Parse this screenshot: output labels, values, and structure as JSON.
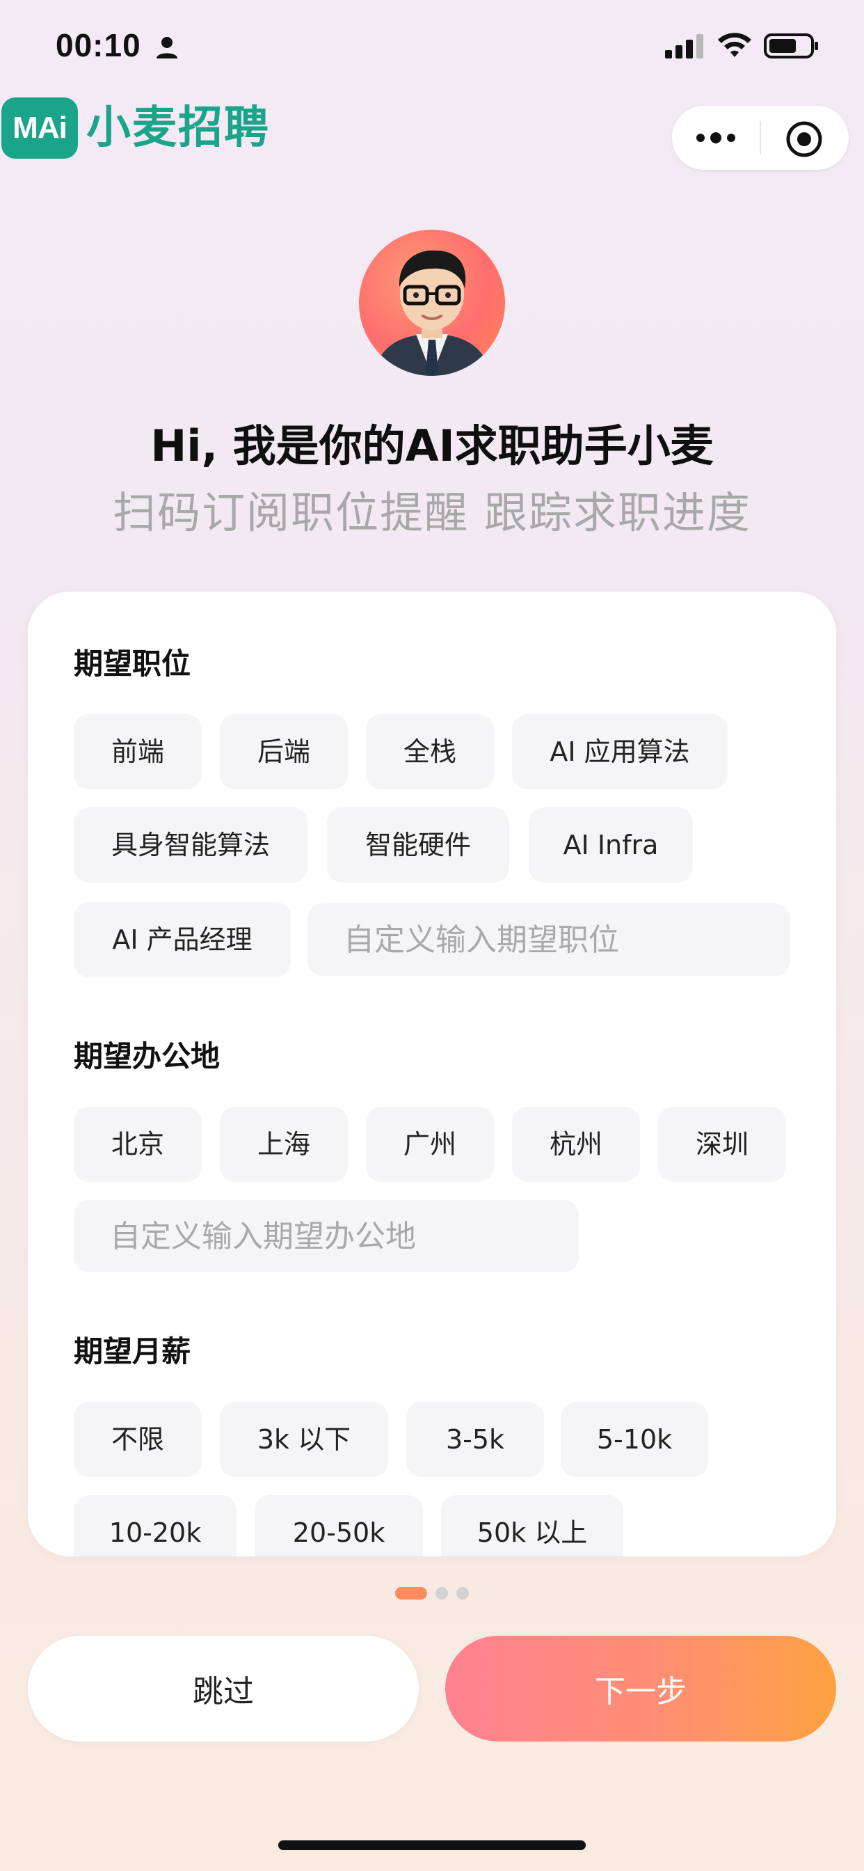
{
  "status_bar": {
    "time": "00:10"
  },
  "header": {
    "logo_text": "MAi",
    "brand_name": "小麦招聘"
  },
  "intro": {
    "headline": "Hi, 我是你的AI求职助手小麦",
    "subline": "扫码订阅职位提醒 跟踪求职进度"
  },
  "form": {
    "position": {
      "title": "期望职位",
      "options": [
        "前端",
        "后端",
        "全栈",
        "AI 应用算法",
        "具身智能算法",
        "智能硬件",
        "AI Infra",
        "AI 产品经理"
      ],
      "custom_placeholder": "自定义输入期望职位"
    },
    "location": {
      "title": "期望办公地",
      "options": [
        "北京",
        "上海",
        "广州",
        "杭州",
        "深圳"
      ],
      "custom_placeholder": "自定义输入期望办公地"
    },
    "salary": {
      "title": "期望月薪",
      "options": [
        "不限",
        "3k 以下",
        "3-5k",
        "5-10k",
        "10-20k",
        "20-50k",
        "50k 以上"
      ]
    }
  },
  "pager": {
    "current": 1,
    "total": 3,
    "active_color": "#ff8a5c",
    "inactive_color": "#d2d2d2"
  },
  "actions": {
    "skip_label": "跳过",
    "next_label": "下一步"
  },
  "colors": {
    "brand": "#1aa58a",
    "accent_start": "#ff7b8d",
    "accent_end": "#ff9d3a"
  }
}
